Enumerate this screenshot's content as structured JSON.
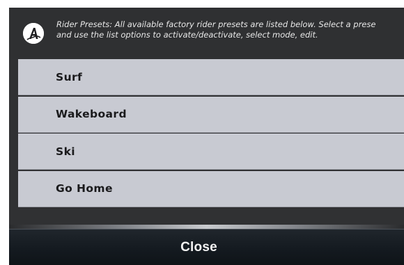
{
  "header": {
    "icon": "brand-logo-icon",
    "description_line1": "Rider Presets: All available factory rider presets are listed below. Select a prese",
    "description_line2": "and use the list options to activate/deactivate, select mode, edit."
  },
  "presets": [
    {
      "label": "Surf"
    },
    {
      "label": "Wakeboard"
    },
    {
      "label": "Ski"
    },
    {
      "label": "Go Home"
    }
  ],
  "footer": {
    "close_label": "Close"
  },
  "colors": {
    "panel_bg": "#303133",
    "list_item_bg": "#c8cad2",
    "close_bar_bg": "#141a20",
    "text_light": "#e8e8e8",
    "text_dark": "#1a1a1c"
  }
}
